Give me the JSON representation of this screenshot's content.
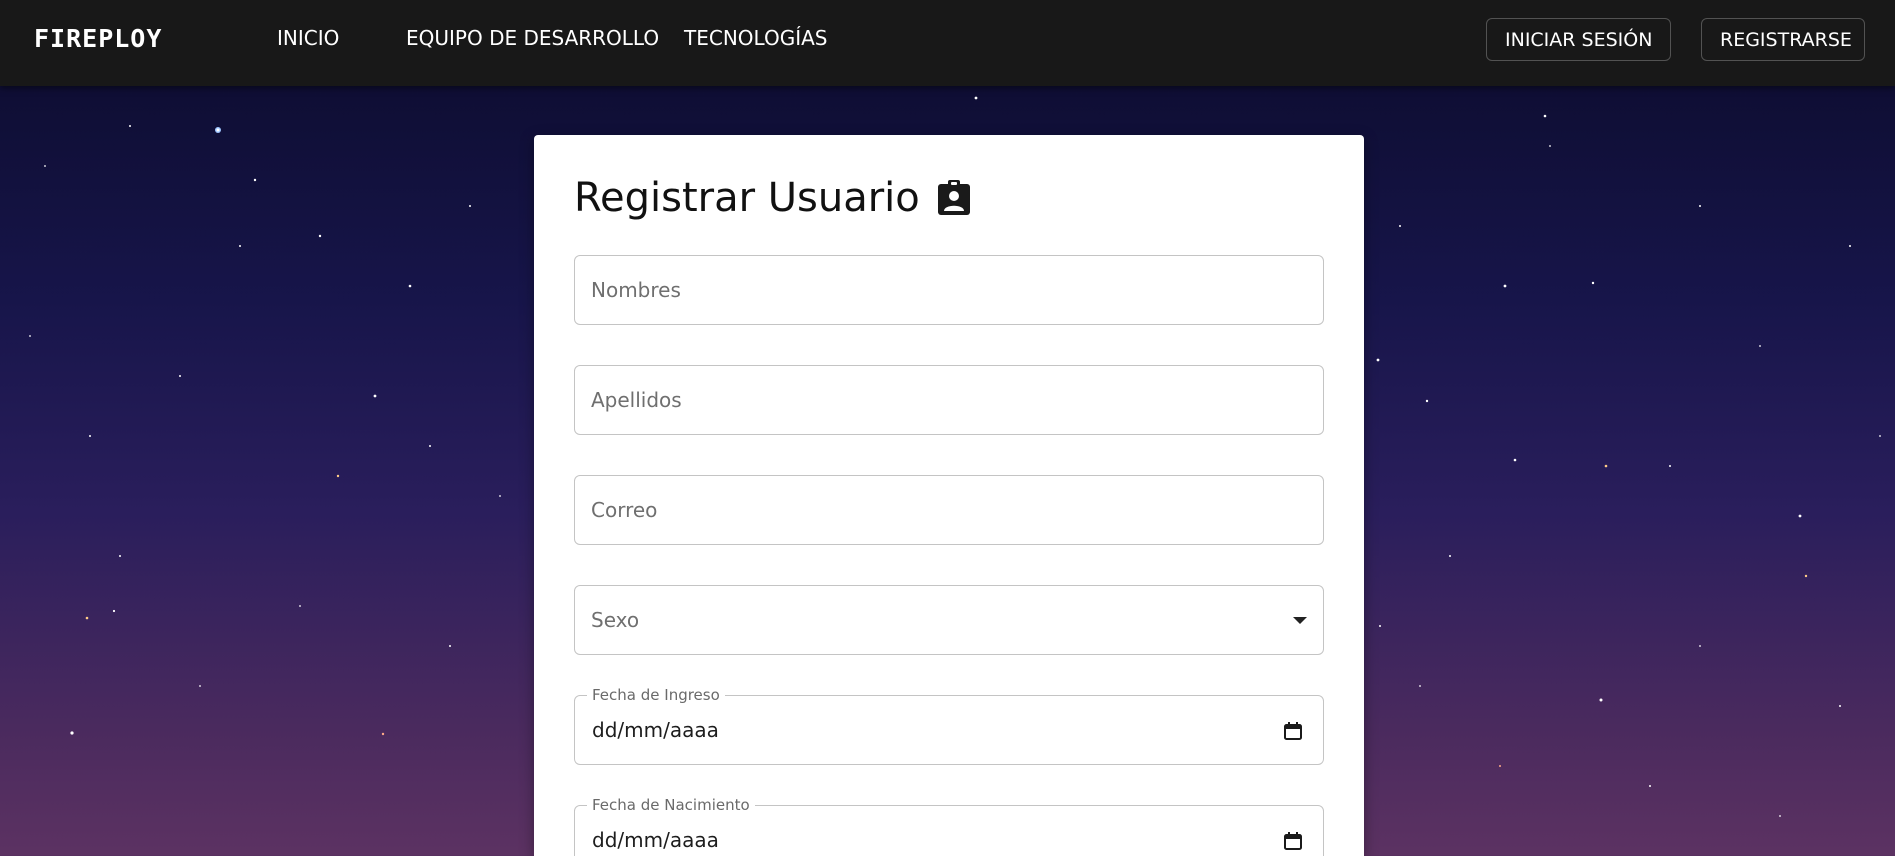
{
  "navbar": {
    "brand": "FIREPLOY",
    "links": [
      {
        "label": "INICIO"
      },
      {
        "label": "EQUIPO DE DESARROLLO"
      },
      {
        "label": "TECNOLOGÍAS"
      }
    ],
    "login_label": "INICIAR SESIÓN",
    "signup_label": "REGISTRARSE"
  },
  "form": {
    "title": "Registrar Usuario",
    "title_icon": "contact-badge-icon",
    "nombres_placeholder": "Nombres",
    "apellidos_placeholder": "Apellidos",
    "correo_placeholder": "Correo",
    "sexo_placeholder": "Sexo",
    "fecha_ingreso_label": "Fecha de Ingreso",
    "fecha_ingreso_value": "dd/mm/aaaa",
    "fecha_nacimiento_label": "Fecha de Nacimiento",
    "fecha_nacimiento_value": "dd/mm/aaaa",
    "calendar_icon": "calendar-icon",
    "dropdown_icon": "caret-down-icon"
  },
  "colors": {
    "navbar_bg": "#181818",
    "card_bg": "#ffffff",
    "field_border": "#c4c4c4",
    "sky_top": "#0b0b2b",
    "sky_bottom": "#5c3262"
  }
}
